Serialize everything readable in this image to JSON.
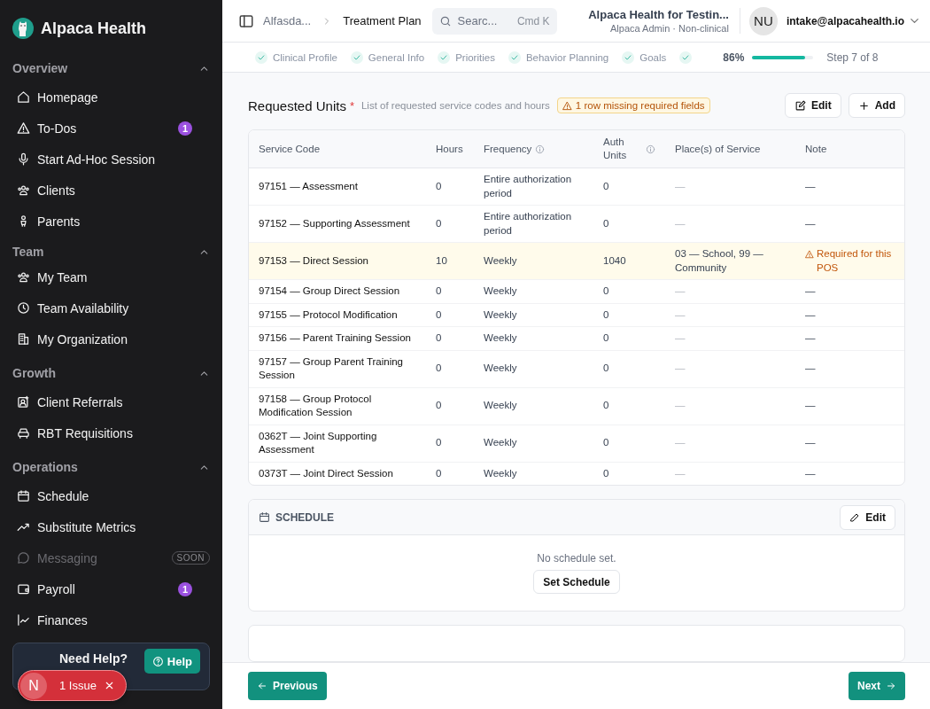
{
  "sidebar": {
    "brand": "Alpaca Health",
    "sections": [
      {
        "title": "Overview",
        "expanded": true,
        "items": [
          {
            "label": "Homepage",
            "disabled": false
          },
          {
            "label": "To-Dos",
            "badge": "1",
            "disabled": false
          },
          {
            "label": "Start Ad-Hoc Session",
            "disabled": false
          },
          {
            "label": "Clients",
            "disabled": false
          },
          {
            "label": "Parents",
            "disabled": false
          }
        ]
      },
      {
        "title": "Team",
        "expanded": true,
        "items": [
          {
            "label": "My Team",
            "disabled": false
          },
          {
            "label": "Team Availability",
            "disabled": false
          },
          {
            "label": "My Organization",
            "disabled": false
          }
        ]
      },
      {
        "title": "Growth",
        "expanded": true,
        "items": [
          {
            "label": "Client Referrals",
            "disabled": false
          },
          {
            "label": "RBT Requisitions",
            "disabled": false
          }
        ]
      },
      {
        "title": "Operations",
        "expanded": true,
        "items": [
          {
            "label": "Schedule",
            "disabled": false
          },
          {
            "label": "Substitute Metrics",
            "disabled": false
          },
          {
            "label": "Messaging",
            "tag": "SOON",
            "disabled": true
          },
          {
            "label": "Payroll",
            "badge": "1",
            "disabled": false
          },
          {
            "label": "Finances",
            "disabled": false
          }
        ]
      }
    ],
    "help": {
      "title": "Need Help?",
      "button": "Help"
    }
  },
  "header": {
    "breadcrumbs": [
      "Alfasda...",
      "Treatment Plan"
    ],
    "search": {
      "placeholder": "Searc...",
      "shortcut": "Cmd K"
    },
    "org": {
      "name": "Alpaca Health for Testin...",
      "role": "Alpaca Admin · Non-clinical"
    },
    "user": {
      "initials": "NU",
      "email": "intake@alpacahealth.io"
    }
  },
  "steps": [
    {
      "label": "Clinical Profile",
      "done": true
    },
    {
      "label": "General Info",
      "done": true
    },
    {
      "label": "Priorities",
      "done": true
    },
    {
      "label": "Behavior Planning",
      "done": true
    },
    {
      "label": "Goals",
      "done": true
    },
    {
      "done": true
    }
  ],
  "progress": {
    "percent": "86%",
    "level": 0.86,
    "step": "Step 7 of 8"
  },
  "requested_units": {
    "title": "Requested Units",
    "required_mark": "*",
    "description": "List of requested service codes and hours",
    "warning": "1 row missing required fields",
    "buttons": [
      "Edit",
      "Add"
    ],
    "table": {
      "columns": [
        {
          "label": "Service Code",
          "info": false
        },
        {
          "label": "Hours",
          "info": false
        },
        {
          "label": "Frequency",
          "info": true
        },
        {
          "label": "Auth Units",
          "info": true
        },
        {
          "label": "Place(s) of Service",
          "info": false
        },
        {
          "label": "Note",
          "info": false
        }
      ],
      "rows": [
        {
          "warning": false,
          "cells": [
            "97151 — Assessment",
            "0",
            "Entire authorization period",
            "0",
            "—",
            "—"
          ]
        },
        {
          "warning": false,
          "cells": [
            "97152 — Supporting Assessment",
            "0",
            "Entire authorization period",
            "0",
            "—",
            "—"
          ]
        },
        {
          "warning": true,
          "cells": [
            "97153 — Direct Session",
            "10",
            "Weekly",
            "1040",
            "03 — School, 99 — Community",
            "Required for this POS"
          ]
        },
        {
          "warning": false,
          "cells": [
            "97154 — Group Direct Session",
            "0",
            "Weekly",
            "0",
            "—",
            "—"
          ]
        },
        {
          "warning": false,
          "cells": [
            "97155 — Protocol Modification",
            "0",
            "Weekly",
            "0",
            "—",
            "—"
          ]
        },
        {
          "warning": false,
          "cells": [
            "97156 — Parent Training Session",
            "0",
            "Weekly",
            "0",
            "—",
            "—"
          ]
        },
        {
          "warning": false,
          "cells": [
            "97157 — Group Parent Training Session",
            "0",
            "Weekly",
            "0",
            "—",
            "—"
          ]
        },
        {
          "warning": false,
          "cells": [
            "97158 — Group Protocol Modification Session",
            "0",
            "Weekly",
            "0",
            "—",
            "—"
          ]
        },
        {
          "warning": false,
          "cells": [
            "0362T — Joint Supporting Assessment",
            "0",
            "Weekly",
            "0",
            "—",
            "—"
          ]
        },
        {
          "warning": false,
          "cells": [
            "0373T — Joint Direct Session",
            "0",
            "Weekly",
            "0",
            "—",
            "—"
          ]
        }
      ]
    }
  },
  "schedule": {
    "title": "SCHEDULE",
    "edit": "Edit",
    "empty": "No schedule set.",
    "button": "Set Schedule"
  },
  "footer": {
    "previous": "Previous",
    "next": "Next"
  },
  "toast": {
    "avatar": "N",
    "label": "1 Issue"
  }
}
